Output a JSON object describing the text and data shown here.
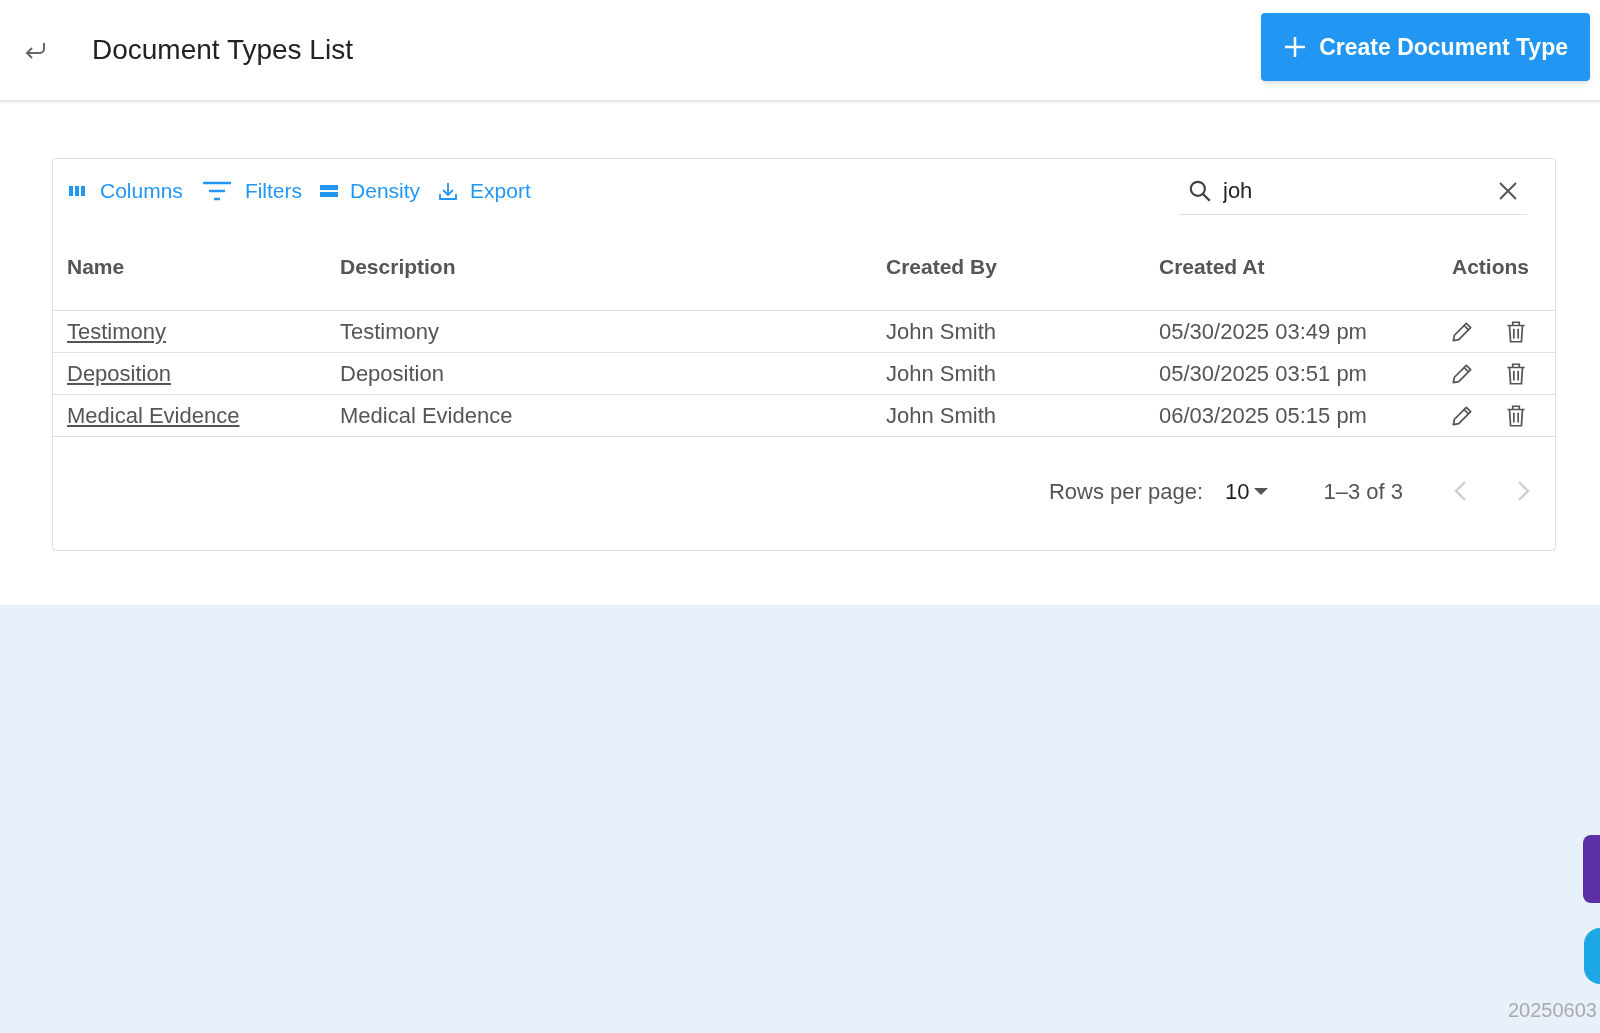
{
  "header": {
    "title": "Document Types List",
    "create_button": "Create Document Type"
  },
  "toolbar": {
    "buttons": [
      {
        "kind": "columns",
        "label": "Columns"
      },
      {
        "kind": "filters",
        "label": "Filters"
      },
      {
        "kind": "density",
        "label": "Density"
      },
      {
        "kind": "export",
        "label": "Export"
      }
    ],
    "search": {
      "value": "joh"
    }
  },
  "table": {
    "columns": [
      "Name",
      "Description",
      "Created By",
      "Created At",
      "Actions"
    ],
    "rows": [
      {
        "name": "Testimony",
        "description": "Testimony",
        "created_by": "John Smith",
        "created_at": "05/30/2025 03:49 pm"
      },
      {
        "name": "Deposition",
        "description": "Deposition",
        "created_by": "John Smith",
        "created_at": "05/30/2025 03:51 pm"
      },
      {
        "name": "Medical Evidence",
        "description": "Medical Evidence",
        "created_by": "John Smith",
        "created_at": "06/03/2025 05:15 pm"
      }
    ]
  },
  "pagination": {
    "rows_per_page_label": "Rows per page:",
    "rows_per_page": "10",
    "range": "1–3 of 3"
  },
  "version": "20250603"
}
